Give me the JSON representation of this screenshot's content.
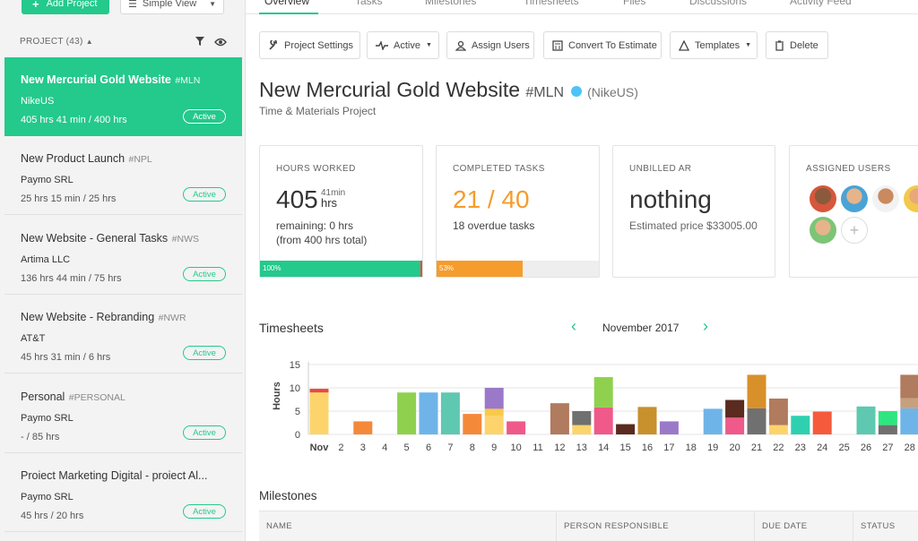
{
  "sidebar": {
    "add_project_label": "Add Project",
    "view_select_label": "Simple View",
    "project_count_label": "PROJECT (43)",
    "projects": [
      {
        "name": "New Mercurial Gold Website",
        "code": "#MLN",
        "client": "NikeUS",
        "hours": "405 hrs 41 min / 400 hrs",
        "status": "Active"
      },
      {
        "name": "New Product Launch",
        "code": "#NPL",
        "client": "Paymo SRL",
        "hours": "25 hrs 15 min / 25 hrs",
        "status": "Active"
      },
      {
        "name": "New Website - General Tasks",
        "code": "#NWS",
        "client": "Artima LLC",
        "hours": "136 hrs 44 min / 75 hrs",
        "status": "Active"
      },
      {
        "name": "New Website - Rebranding",
        "code": "#NWR",
        "client": "AT&T",
        "hours": "45 hrs 31 min / 6 hrs",
        "status": "Active"
      },
      {
        "name": "Personal",
        "code": "#PERSONAL",
        "client": "Paymo SRL",
        "hours": "- / 85 hrs",
        "status": "Active"
      },
      {
        "name": "Proiect Marketing Digital - proiect Al...",
        "code": "",
        "client": "Paymo SRL",
        "hours": "45 hrs / 20 hrs",
        "status": "Active"
      }
    ]
  },
  "tabs": [
    "Overview",
    "Tasks",
    "Milestones",
    "Timesheets",
    "Files",
    "Discussions",
    "Activity Feed"
  ],
  "toolbar": {
    "project_settings": "Project Settings",
    "active": "Active",
    "assign_users": "Assign Users",
    "convert": "Convert To Estimate",
    "templates": "Templates",
    "delete": "Delete"
  },
  "project": {
    "title": "New Mercurial Gold Website",
    "code": "#MLN",
    "client": "(NikeUS)",
    "type": "Time & Materials Project",
    "client_dot_color": "#4fc3f7"
  },
  "cards": {
    "hours": {
      "title": "HOURS WORKED",
      "value": "405",
      "unit": "hrs",
      "min": "41min",
      "remaining": "remaining: 0 hrs",
      "total": "(from 400 hrs total)",
      "bar_label": "100%",
      "progress": 1.0
    },
    "tasks": {
      "title": "COMPLETED TASKS",
      "value": "21 / 40",
      "overdue": "18 overdue tasks",
      "bar_label": "53%",
      "progress": 0.53
    },
    "unbilled": {
      "title": "UNBILLED AR",
      "value": "nothing",
      "estimated": "Estimated price $33005.00"
    },
    "users": {
      "title": "ASSIGNED USERS"
    }
  },
  "timesheets": {
    "title": "Timesheets",
    "month": "November 2017"
  },
  "milestones": {
    "title": "Milestones",
    "columns": [
      "NAME",
      "PERSON RESPONSIBLE",
      "DUE DATE",
      "STATUS"
    ]
  },
  "chart_data": {
    "type": "bar",
    "stacked": true,
    "ylabel": "Hours",
    "ylim": [
      0,
      15
    ],
    "yticks": [
      0,
      5,
      10,
      15
    ],
    "categories": [
      "Nov",
      "2",
      "3",
      "4",
      "5",
      "6",
      "7",
      "8",
      "9",
      "10",
      "11",
      "12",
      "13",
      "14",
      "15",
      "16",
      "17",
      "18",
      "19",
      "20",
      "21",
      "22",
      "23",
      "24",
      "25",
      "26",
      "27",
      "28"
    ],
    "stacks": [
      [
        [
          9.0,
          "#fcd46b"
        ],
        [
          0.8,
          "#e94b3c"
        ]
      ],
      [],
      [
        [
          2.8,
          "#f4893a"
        ]
      ],
      [],
      [
        [
          9.0,
          "#8fd14f"
        ]
      ],
      [
        [
          9.0,
          "#6fb4e8"
        ]
      ],
      [
        [
          9.0,
          "#5ec8b0"
        ]
      ],
      [
        [
          4.4,
          "#f4893a"
        ]
      ],
      [
        [
          4.0,
          "#fcd46b"
        ],
        [
          1.5,
          "#f8c94a"
        ],
        [
          4.5,
          "#9b79c9"
        ]
      ],
      [
        [
          2.8,
          "#ef5a8a"
        ]
      ],
      [],
      [
        [
          6.7,
          "#b07b5e"
        ]
      ],
      [
        [
          2.0,
          "#fcd46b"
        ],
        [
          3.0,
          "#707070"
        ]
      ],
      [
        [
          5.8,
          "#ef5a8a"
        ],
        [
          6.5,
          "#8fd14f"
        ]
      ],
      [
        [
          2.2,
          "#5a2b1e"
        ]
      ],
      [
        [
          5.9,
          "#c9902e"
        ]
      ],
      [
        [
          2.8,
          "#9b79c9"
        ]
      ],
      [],
      [
        [
          5.5,
          "#6fb4e8"
        ]
      ],
      [
        [
          3.6,
          "#ef5a8a"
        ],
        [
          3.8,
          "#5a2b1e"
        ]
      ],
      [
        [
          5.6,
          "#707070"
        ],
        [
          7.2,
          "#d8902a"
        ]
      ],
      [
        [
          2.0,
          "#fcd46b"
        ],
        [
          5.7,
          "#b07b5e"
        ]
      ],
      [
        [
          4.0,
          "#2fd0b0"
        ]
      ],
      [
        [
          4.9,
          "#f55a3c"
        ]
      ],
      [],
      [
        [
          6.0,
          "#5ec8b0"
        ]
      ],
      [
        [
          2.0,
          "#707070"
        ],
        [
          3.0,
          "#2ee680"
        ]
      ],
      [
        [
          5.6,
          "#6fb4e8"
        ],
        [
          2.2,
          "#c7a07e"
        ],
        [
          5.0,
          "#b07b5e"
        ]
      ]
    ]
  }
}
